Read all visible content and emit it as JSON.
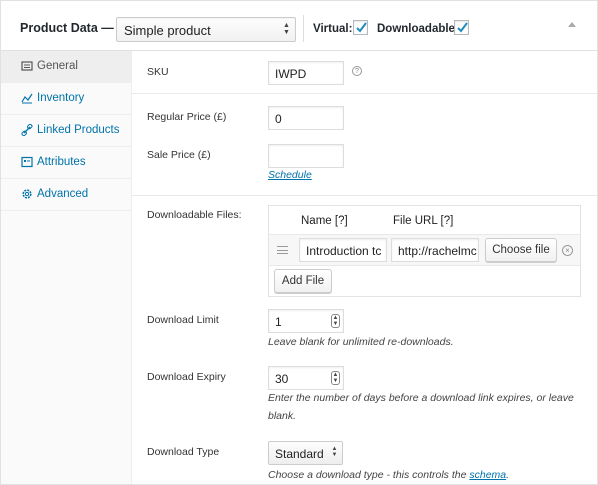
{
  "header": {
    "title": "Product Data —",
    "product_type": "Simple product",
    "virtual_label": "Virtual:",
    "virtual_checked": true,
    "downloadable_label": "Downloadable:",
    "downloadable_checked": true
  },
  "sidebar": {
    "items": [
      {
        "label": "General",
        "icon": "general-icon",
        "active": true
      },
      {
        "label": "Inventory",
        "icon": "inventory-icon",
        "active": false
      },
      {
        "label": "Linked Products",
        "icon": "link-icon",
        "active": false
      },
      {
        "label": "Attributes",
        "icon": "attributes-icon",
        "active": false
      },
      {
        "label": "Advanced",
        "icon": "gear-icon",
        "active": false
      }
    ]
  },
  "general": {
    "sku_label": "SKU",
    "sku_value": "IWPD",
    "sku_help": "?",
    "regular_price_label": "Regular Price (£)",
    "regular_price_value": "0",
    "sale_price_label": "Sale Price (£)",
    "sale_price_value": "",
    "schedule_link": "Schedule"
  },
  "downloads": {
    "label": "Downloadable Files:",
    "col_name": "Name [?]",
    "col_url": "File URL [?]",
    "files": [
      {
        "name": "Introduction tc",
        "url": "http://rachelmc",
        "choose_label": "Choose file",
        "remove": "×"
      }
    ],
    "add_file_label": "Add File"
  },
  "download_limit": {
    "label": "Download Limit",
    "value": "1",
    "desc": "Leave blank for unlimited re-downloads."
  },
  "download_expiry": {
    "label": "Download Expiry",
    "value": "30",
    "desc_line1": "Enter the number of days before a download link expires, or leave",
    "desc_line2": "blank."
  },
  "download_type": {
    "label": "Download Type",
    "value": "Standard",
    "desc_prefix": "Choose a download type - this controls the ",
    "desc_link": "schema",
    "desc_suffix": "."
  },
  "colors": {
    "link": "#0073aa",
    "checkbox_check": "#1e8cbe"
  }
}
